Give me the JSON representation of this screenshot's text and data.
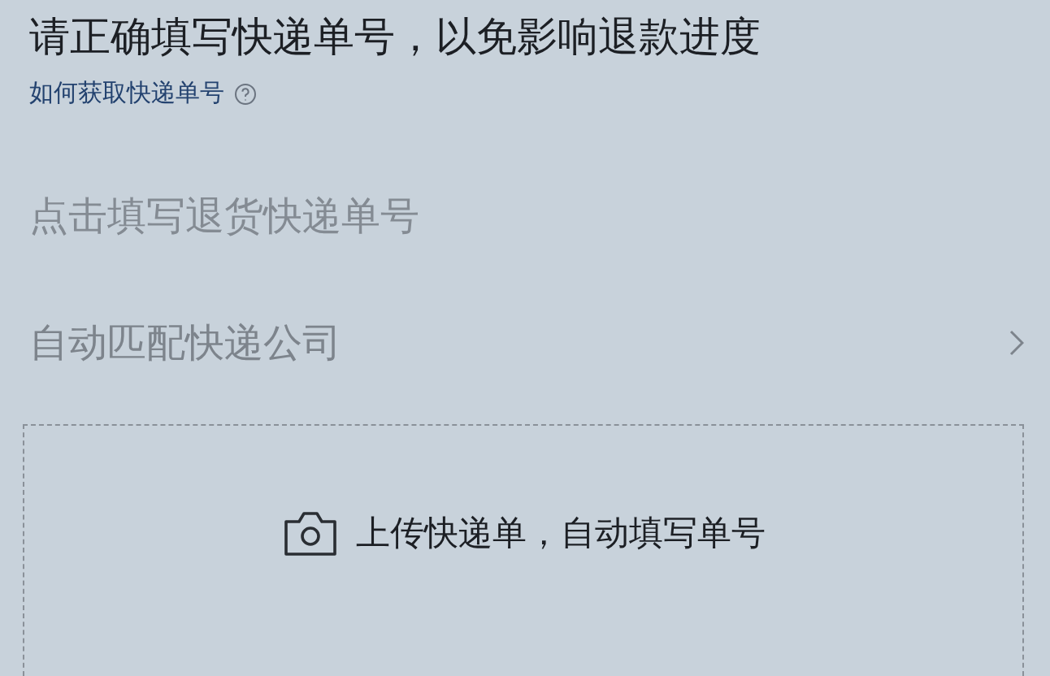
{
  "notice": "请正确填写快递单号，以免影响退款进度",
  "help_link": "如何获取快递单号",
  "tracking_field": {
    "placeholder": "点击填写退货快递单号"
  },
  "courier_row": {
    "label": "自动匹配快递公司"
  },
  "upload": {
    "label": "上传快递单，自动填写单号"
  }
}
